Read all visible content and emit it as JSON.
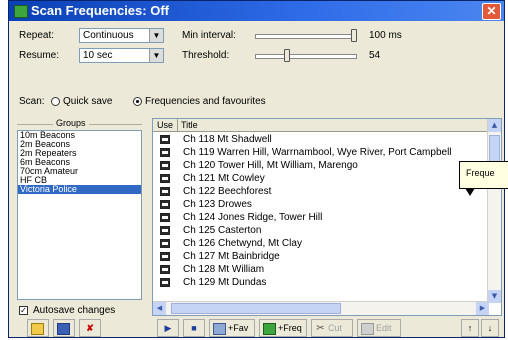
{
  "window": {
    "title": "Scan Frequencies: Off"
  },
  "settings": {
    "repeat_label": "Repeat:",
    "repeat_value": "Continuous",
    "resume_label": "Resume:",
    "resume_value": "10 sec",
    "min_interval_label": "Min interval:",
    "min_interval_value": "100 ms",
    "min_interval_level": 1.0,
    "threshold_label": "Threshold:",
    "threshold_value": "54",
    "threshold_level": 0.3
  },
  "scan": {
    "label": "Scan:",
    "option_quick": "Quick save",
    "option_freq": "Frequencies and favourites",
    "selected": "freq"
  },
  "groups": {
    "legend": "Groups",
    "items": [
      "10m Beacons",
      "2m Beacons",
      "2m Repeaters",
      "6m Beacons",
      "70cm Amateur",
      "HF CB",
      "Victoria Police"
    ],
    "selected_index": 6,
    "autosave_label": "Autosave changes",
    "autosave_checked": true
  },
  "table": {
    "col_use": "Use",
    "col_title": "Title",
    "rows": [
      {
        "title": "Ch 118 Mt Shadwell",
        "use": true
      },
      {
        "title": "Ch 119 Warren Hill, Warrnambool, Wye River, Port Campbell",
        "use": true
      },
      {
        "title": "Ch 120 Tower Hill, Mt William, Marengo",
        "use": true
      },
      {
        "title": "Ch 121 Mt Cowley",
        "use": true
      },
      {
        "title": "Ch 122 Beechforest",
        "use": true
      },
      {
        "title": "Ch 123 Drowes",
        "use": true
      },
      {
        "title": "Ch 124 Jones Ridge, Tower Hill",
        "use": true
      },
      {
        "title": "Ch 125 Casterton",
        "use": true
      },
      {
        "title": "Ch 126 Chetwynd, Mt Clay",
        "use": true
      },
      {
        "title": "Ch 127 Mt Bainbridge",
        "use": true
      },
      {
        "title": "Ch 128 Mt William",
        "use": true
      },
      {
        "title": "Ch 129 Mt Dundas",
        "use": true
      }
    ]
  },
  "tooltip": {
    "text": "Freque"
  },
  "toolbar": {
    "add_fav": "+Fav",
    "add_freq": "+Freq",
    "cut": "Cut",
    "edit": "Edit",
    "up_arrow": "↑",
    "down_arrow": "↓"
  }
}
